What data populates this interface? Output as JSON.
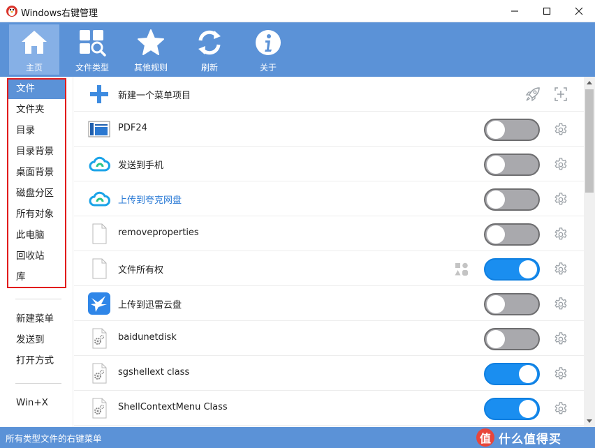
{
  "window": {
    "title": "Windows右键管理"
  },
  "toolbar": {
    "items": [
      {
        "label": "主页",
        "icon": "home-icon",
        "active": true
      },
      {
        "label": "文件类型",
        "icon": "file-types-icon",
        "active": false
      },
      {
        "label": "其他规则",
        "icon": "star-icon",
        "active": false
      },
      {
        "label": "刷新",
        "icon": "refresh-icon",
        "active": false
      },
      {
        "label": "关于",
        "icon": "info-icon",
        "active": false
      }
    ]
  },
  "sidebar": {
    "group1": [
      "文件",
      "文件夹",
      "目录",
      "目录背景",
      "桌面背景",
      "磁盘分区",
      "所有对象",
      "此电脑",
      "回收站",
      "库"
    ],
    "group2": [
      "新建菜单",
      "发送到",
      "打开方式"
    ],
    "group3": [
      "Win+X"
    ],
    "active": "文件"
  },
  "list": {
    "header_label": "新建一个菜单项目",
    "rows": [
      {
        "label": "PDF24",
        "icon": "pdf24-icon",
        "enabled": false,
        "link": false
      },
      {
        "label": "发送到手机",
        "icon": "cloud-icon",
        "enabled": false,
        "link": false
      },
      {
        "label": "上传到夸克网盘",
        "icon": "cloud-icon",
        "enabled": false,
        "link": true
      },
      {
        "label": "removeproperties",
        "icon": "blank-file-icon",
        "enabled": false,
        "link": false
      },
      {
        "label": "文件所有权",
        "icon": "blank-file-icon",
        "enabled": true,
        "link": false,
        "extra": "shapes-icon"
      },
      {
        "label": "上传到迅雷云盘",
        "icon": "thunder-bird-icon",
        "enabled": false,
        "link": false
      },
      {
        "label": "baidunetdisk",
        "icon": "gear-file-icon",
        "enabled": false,
        "link": false
      },
      {
        "label": "sgshellext class",
        "icon": "gear-file-icon",
        "enabled": true,
        "link": false
      },
      {
        "label": "ShellContextMenu Class",
        "icon": "gear-file-icon",
        "enabled": true,
        "link": false
      }
    ]
  },
  "status": {
    "text": "所有类型文件的右键菜单"
  },
  "watermark": {
    "logo": "值",
    "text": "什么值得买"
  },
  "colors": {
    "accent": "#5b92d7",
    "toggle_on": "#1a8ef0",
    "highlight_box": "#e21b1b",
    "link": "#2b7bd6"
  }
}
